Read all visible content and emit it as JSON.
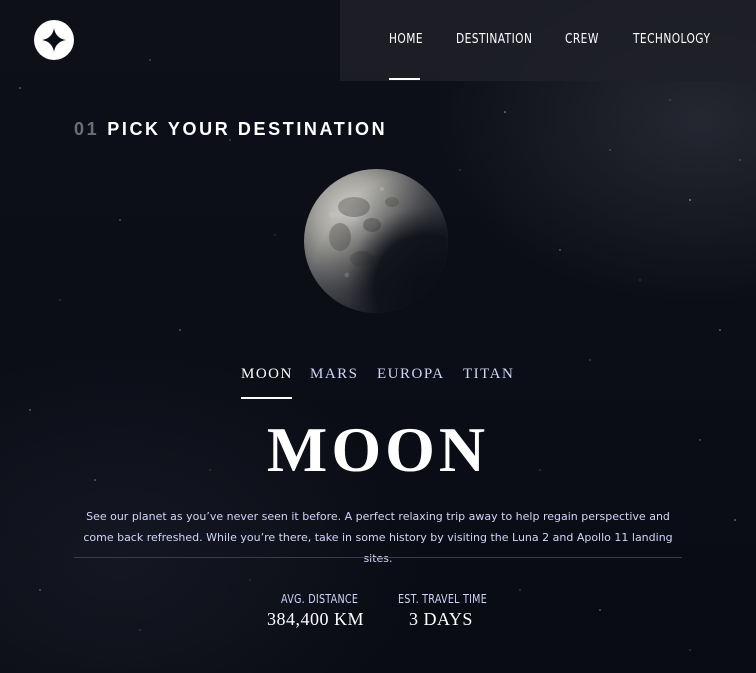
{
  "nav": {
    "items": [
      {
        "label": "HOME",
        "active": true
      },
      {
        "label": "DESTINATION",
        "active": false
      },
      {
        "label": "CREW",
        "active": false
      },
      {
        "label": "TECHNOLOGY",
        "active": false
      }
    ]
  },
  "page": {
    "heading_number": "01",
    "heading_text": "PICK YOUR DESTINATION"
  },
  "destination": {
    "tabs": [
      {
        "label": "MOON",
        "active": true
      },
      {
        "label": "MARS",
        "active": false
      },
      {
        "label": "EUROPA",
        "active": false
      },
      {
        "label": "TITAN",
        "active": false
      }
    ],
    "name": "MOON",
    "description": "See our planet as you’ve never seen it before. A perfect relaxing trip away to help regain perspective and come back refreshed. While you’re there, take in some history by visiting the Luna 2 and Apollo 11 landing sites.",
    "stats": {
      "distance_label": "AVG. DISTANCE",
      "distance_value": "384,400 KM",
      "time_label": "EST. TRAVEL TIME",
      "time_value": "3 DAYS"
    }
  },
  "icons": {
    "logo": "four-point-star-icon",
    "planet": "moon-image"
  },
  "colors": {
    "background": "#0b0d17",
    "text": "#ffffff",
    "muted_text": "#d0d6f9",
    "nav_bg": "#1e2028"
  }
}
